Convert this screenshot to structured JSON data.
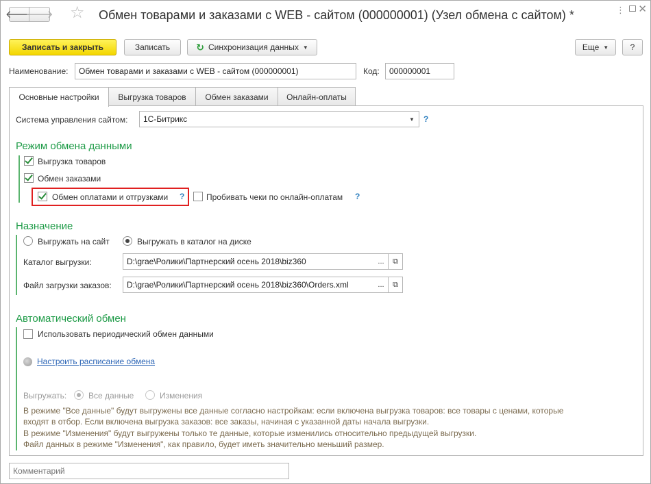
{
  "window": {
    "title": "Обмен товарами и заказами с WEB - сайтом (000000001) (Узел обмена с сайтом) *",
    "nav_back": "🡐",
    "nav_forward": "🡒",
    "favorite_icon": "☆"
  },
  "toolbar": {
    "save_close": "Записать и закрыть",
    "save": "Записать",
    "sync": "Синхронизация данных",
    "more": "Еще",
    "help": "?"
  },
  "header": {
    "name_label": "Наименование:",
    "name_value": "Обмен товарами и заказами с WEB - сайтом (000000001)",
    "code_label": "Код:",
    "code_value": "000000001"
  },
  "tabs": [
    {
      "label": "Основные настройки",
      "active": true
    },
    {
      "label": "Выгрузка товаров",
      "active": false
    },
    {
      "label": "Обмен заказами",
      "active": false
    },
    {
      "label": "Онлайн-оплаты",
      "active": false
    }
  ],
  "cms": {
    "label": "Система управления сайтом:",
    "value": "1С-Битрикс",
    "help": "?"
  },
  "exchange_mode": {
    "title": "Режим обмена данными",
    "export_goods": {
      "label": "Выгрузка товаров",
      "checked": true
    },
    "exchange_orders": {
      "label": "Обмен заказами",
      "checked": true
    },
    "payments_shipments": {
      "label": "Обмен оплатами и отгрузками",
      "checked": true,
      "help": "?"
    },
    "receipts": {
      "label": "Пробивать чеки по онлайн-оплатам",
      "checked": false,
      "help": "?"
    }
  },
  "destination": {
    "title": "Назначение",
    "to_site": {
      "label": "Выгружать на сайт",
      "selected": false
    },
    "to_disk": {
      "label": "Выгружать в каталог на диске",
      "selected": true
    },
    "catalog_label": "Каталог выгрузки:",
    "catalog_value": "D:\\grae\\Ролики\\Партнерский осень 2018\\biz360",
    "orders_file_label": "Файл загрузки заказов:",
    "orders_file_value": "D:\\grae\\Ролики\\Партнерский осень 2018\\biz360\\Orders.xml",
    "select_btn": "...",
    "open_icon": "⧉"
  },
  "auto_exchange": {
    "title": "Автоматический обмен",
    "periodic": {
      "label": "Использовать периодический обмен данными",
      "checked": false
    },
    "schedule_link": "Настроить расписание обмена",
    "export_label": "Выгружать:",
    "all_data": {
      "label": "Все данные",
      "selected": true
    },
    "changes": {
      "label": "Изменения",
      "selected": false
    },
    "description": [
      "В режиме \"Все данные\" будут выгружены все данные согласно настройкам: если включена выгрузка товаров: все товары с ценами, которые",
      "входят в отбор. Если включена выгрузка заказов: все заказы, начиная с указанной даты начала выгрузки.",
      "В режиме \"Изменения\" будут выгружены только те данные, которые изменились относительно предыдущей выгрузки.",
      "Файл данных в режиме \"Изменения\", как правило, будет иметь значительно меньший размер."
    ]
  },
  "comment": {
    "placeholder": "Комментарий",
    "value": ""
  }
}
